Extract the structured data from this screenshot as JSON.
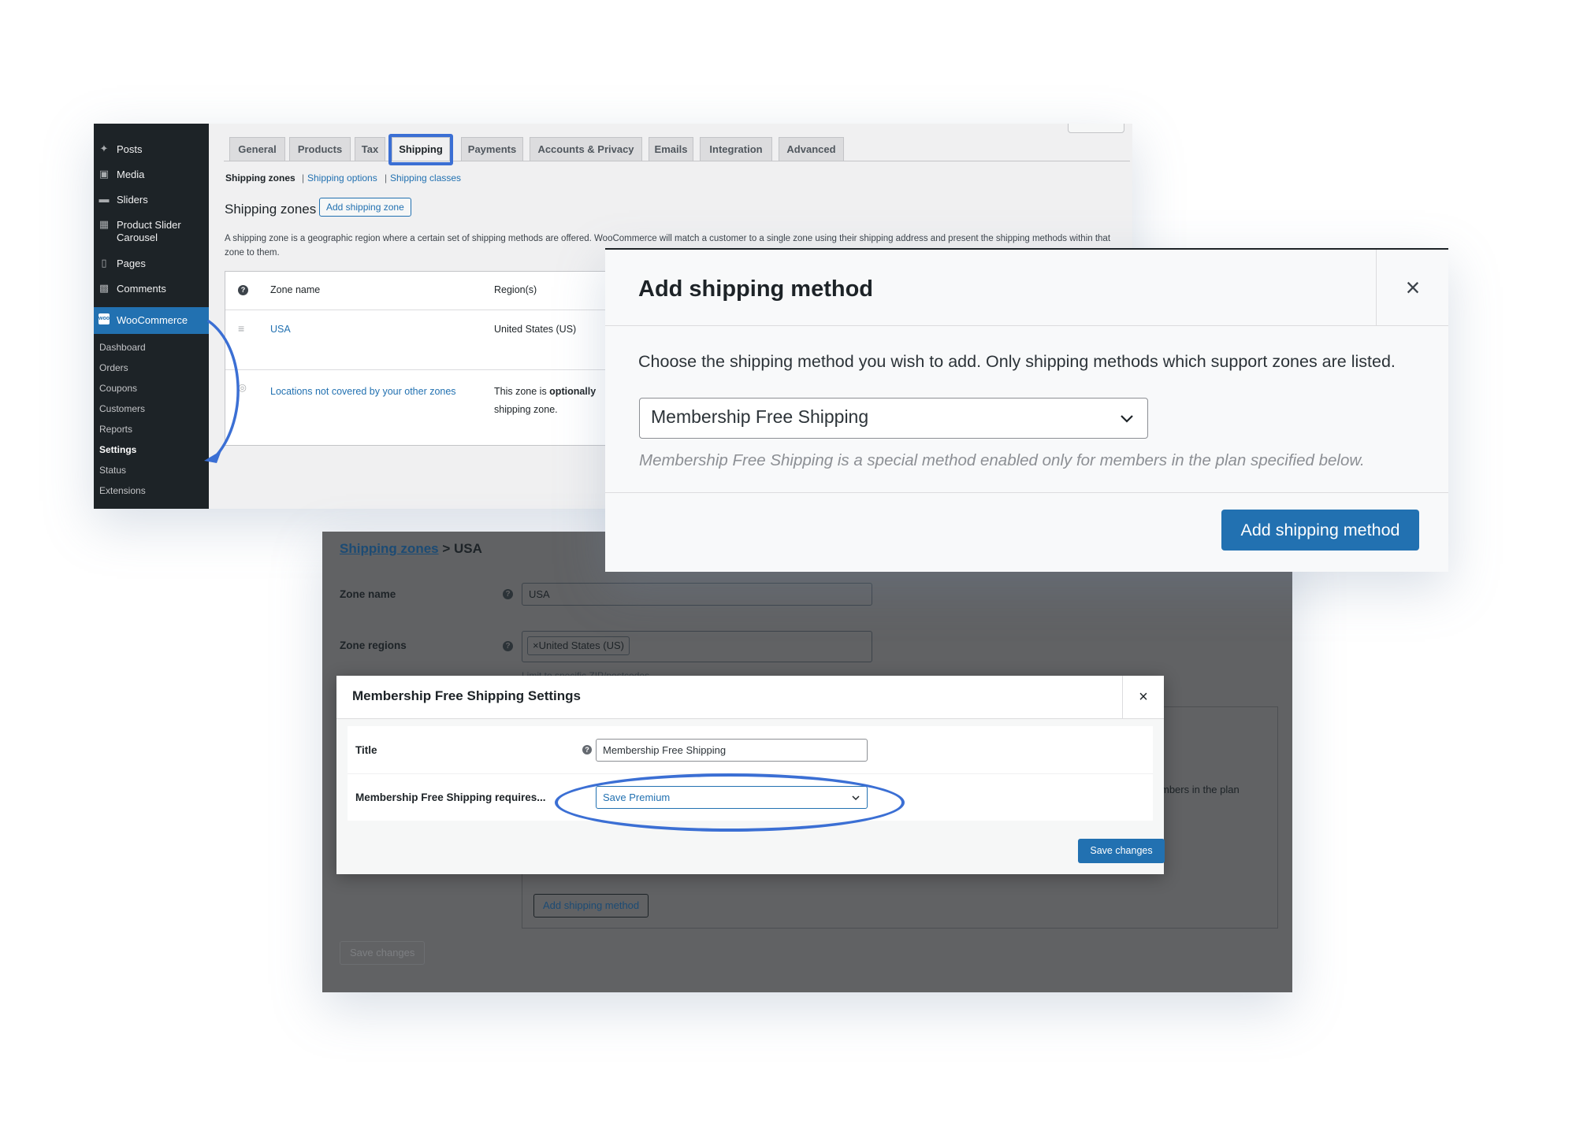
{
  "sidebar": {
    "menu": [
      {
        "label": "Posts",
        "icon": "pin-icon"
      },
      {
        "label": "Media",
        "icon": "media-icon"
      },
      {
        "label": "Sliders",
        "icon": "sliders-icon"
      },
      {
        "label": "Product Slider Carousel",
        "icon": "carousel-icon"
      },
      {
        "label": "Pages",
        "icon": "pages-icon"
      },
      {
        "label": "Comments",
        "icon": "comment-icon"
      }
    ],
    "woocommerce": {
      "label": "WooCommerce",
      "icon_text": "woo"
    },
    "submenu": [
      "Dashboard",
      "Orders",
      "Coupons",
      "Customers",
      "Reports",
      "Settings",
      "Status",
      "Extensions"
    ]
  },
  "settings": {
    "tabs": [
      "General",
      "Products",
      "Tax",
      "Shipping",
      "Payments",
      "Accounts & Privacy",
      "Emails",
      "Integration",
      "Advanced"
    ],
    "active_tab": "Shipping",
    "subsub": {
      "current": "Shipping zones",
      "links": [
        "Shipping options",
        "Shipping classes"
      ],
      "separator": "|"
    },
    "heading": "Shipping zones",
    "add_zone_label": "Add shipping zone",
    "description": "A shipping zone is a geographic region where a certain set of shipping methods are offered. WooCommerce will match a customer to a single zone using their shipping address and present the shipping methods within that zone to them.",
    "table": {
      "headers": {
        "zone_name": "Zone name",
        "regions": "Region(s)"
      },
      "rows": [
        {
          "zone": "USA",
          "region": "United States (US)"
        },
        {
          "zone": "Locations not covered by your other zones",
          "region": "This zone is optionally used for regions that are not included in any other shipping zone."
        }
      ],
      "row2_region_prefix": "This zone is ",
      "row2_region_bold": "optionally",
      "row2_region_line2": "shipping zone."
    }
  },
  "add_method_modal": {
    "title": "Add shipping method",
    "close": "×",
    "description": "Choose the shipping method you wish to add. Only shipping methods which support zones are listed.",
    "selected_method": "Membership Free Shipping",
    "help_text": "Membership Free Shipping is a special method enabled only for members in the plan specified below.",
    "submit_label": "Add shipping method"
  },
  "zone_page": {
    "breadcrumb": {
      "link": "Shipping zones",
      "separator": " > ",
      "current": "USA"
    },
    "zone_name_label": "Zone name",
    "zone_name_value": "USA",
    "zone_regions_label": "Zone regions",
    "region_chip": "×United States (US)",
    "limit_link": "Limit to specific ZIP/postcodes",
    "behind_text": "mbers in the plan",
    "add_method_label": "Add shipping method",
    "save_label": "Save changes",
    "help_glyph": "?"
  },
  "settings_modal": {
    "title": "Membership Free Shipping Settings",
    "close": "×",
    "title_label": "Title",
    "title_value": "Membership Free Shipping",
    "requires_label": "Membership Free Shipping requires...",
    "requires_value": "Save Premium",
    "save_label": "Save changes"
  },
  "colors": {
    "wp_dark": "#1d2327",
    "wp_blue": "#2271b1",
    "annotation_blue": "#3b6fd4",
    "overlay_gray": "#616264"
  }
}
